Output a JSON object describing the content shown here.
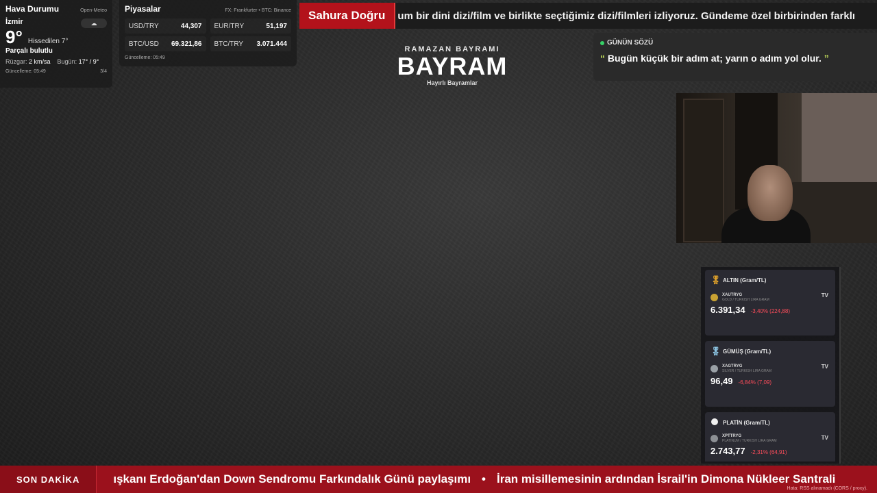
{
  "weather": {
    "title": "Hava Durumu",
    "source": "Open-Meteo",
    "city": "İzmir",
    "temp": "9°",
    "feels": "Hissedilen 7°",
    "condition": "Parçalı bulutlu",
    "wind_label": "Rüzgar:",
    "wind": "2 km/sa",
    "today_label": "Bugün:",
    "today": "17° / 9°",
    "updated": "Güncelleme: 05:49",
    "page": "3/4",
    "icon": "partly-cloudy-icon"
  },
  "markets": {
    "title": "Piyasalar",
    "source": "FX: Frankfurter • BTC: Binance",
    "items": [
      {
        "label": "USD/TRY",
        "value": "44,307"
      },
      {
        "label": "EUR/TRY",
        "value": "51,197"
      },
      {
        "label": "BTC/USD",
        "value": "69.321,86"
      },
      {
        "label": "BTC/TRY",
        "value": "3.071.444"
      }
    ],
    "updated": "Güncelleme: 05:49"
  },
  "top_ticker": {
    "badge": "Sahura Doğru",
    "text": "um bir dini dizi/film ve birlikte seçtiğimiz dizi/filmleri izliyoruz. Gündeme özel birbirinden farklı"
  },
  "center": {
    "subtitle": "RAMAZAN BAYRAMI",
    "title": "BAYRAM",
    "footer": "Hayırlı Bayramlar"
  },
  "quote": {
    "label": "GÜNÜN SÖZÜ",
    "open_mark": "“",
    "text": "Bugün küçük bir adım at; yarın o adım yol olur.",
    "close_mark": "”"
  },
  "metals": [
    {
      "title": "ALTIN (Gram/TL)",
      "symbol": "XAUTRYG",
      "sub": "GOLD / TURKISH LIRA GRAM",
      "price": "6.391,34",
      "change": "-3,40% (224,88)",
      "medal": "gold-medal-icon",
      "coin_color": "#c9a233"
    },
    {
      "title": "GÜMÜŞ (Gram/TL)",
      "symbol": "XAGTRYG",
      "sub": "SILVER / TURKISH LIRA GRAM",
      "price": "96,49",
      "change": "-6,84% (7,09)",
      "medal": "silver-medal-icon",
      "coin_color": "#9aa0a6"
    },
    {
      "title": "PLATİN (Gram/TL)",
      "symbol": "XPTTRYG",
      "sub": "PLATINUM / TURKISH LIRA GRAM",
      "price": "2.743,77",
      "change": "-2,31% (64,91)",
      "medal": "platinum-dot-icon",
      "coin_color": "#8c8f94"
    }
  ],
  "tv_mark": "TV",
  "bottom_ticker": {
    "badge": "SON DAKİKA",
    "items": [
      "ışkanı Erdoğan'dan Down Sendromu Farkındalık Günü paylaşımı",
      "İran misillemesinin ardından İsrail'in Dimona Nükleer Santrali"
    ],
    "separator": "•",
    "error": "Hata: RSS alınamadı (CORS / proxy)."
  }
}
